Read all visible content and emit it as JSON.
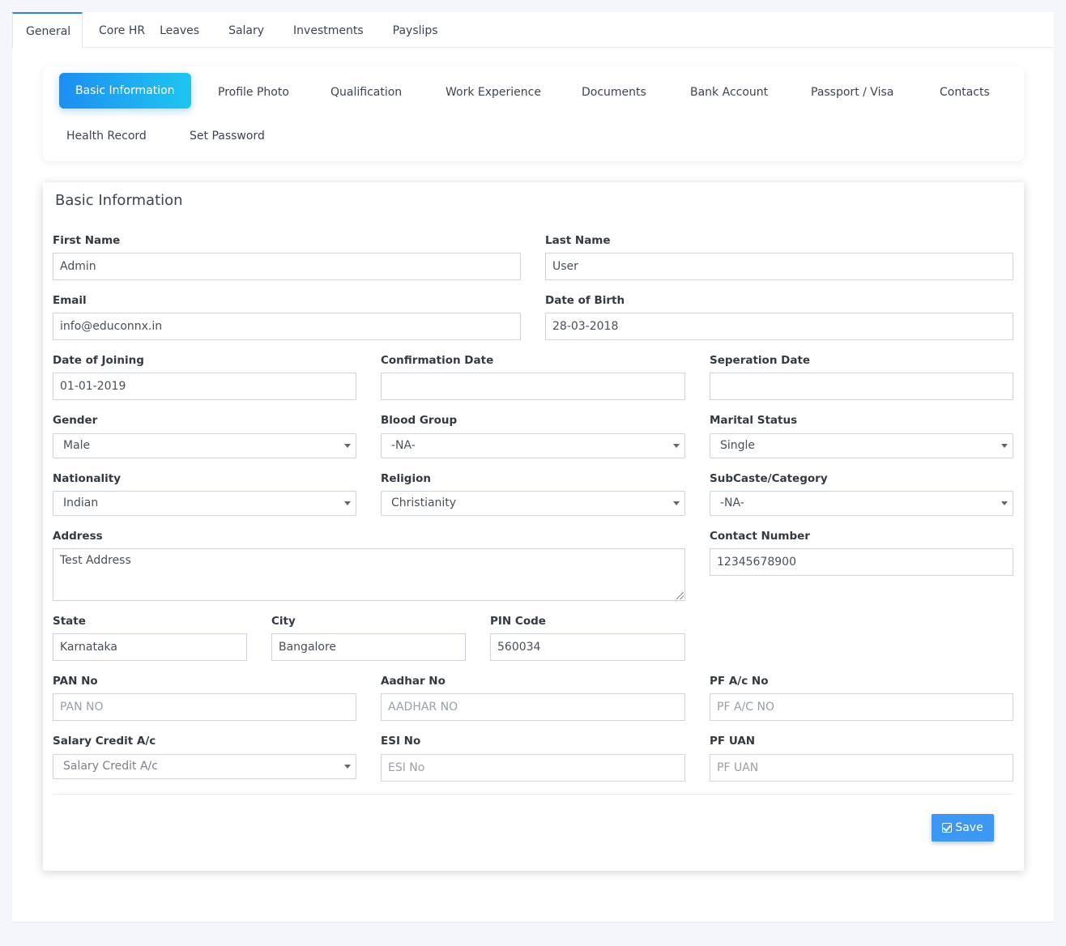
{
  "top_tabs": [
    "General",
    "Core HR",
    "Leaves",
    "Salary",
    "Investments",
    "Payslips"
  ],
  "sub_tabs": [
    "Basic Information",
    "Profile Photo",
    "Qualification",
    "Work Experience",
    "Documents",
    "Bank Account",
    "Passport / Visa",
    "Contacts",
    "Health Record",
    "Set Password"
  ],
  "form": {
    "title": "Basic Information",
    "first_name": {
      "label": "First Name",
      "value": "Admin"
    },
    "last_name": {
      "label": "Last Name",
      "value": "User"
    },
    "email": {
      "label": "Email",
      "value": "info@educonnx.in"
    },
    "dob": {
      "label": "Date of Birth",
      "value": "28-03-2018"
    },
    "doj": {
      "label": "Date of Joining",
      "value": "01-01-2019"
    },
    "confirmation_date": {
      "label": "Confirmation Date",
      "value": ""
    },
    "separation_date": {
      "label": "Seperation Date",
      "value": ""
    },
    "gender": {
      "label": "Gender",
      "value": "Male"
    },
    "blood_group": {
      "label": "Blood Group",
      "value": "-NA-"
    },
    "marital_status": {
      "label": "Marital Status",
      "value": "Single"
    },
    "nationality": {
      "label": "Nationality",
      "value": "Indian"
    },
    "religion": {
      "label": "Religion",
      "value": "Christianity"
    },
    "subcaste": {
      "label": "SubCaste/Category",
      "value": "-NA-"
    },
    "address": {
      "label": "Address",
      "value": "Test Address"
    },
    "contact_number": {
      "label": "Contact Number",
      "value": "12345678900"
    },
    "state": {
      "label": "State",
      "value": "Karnataka"
    },
    "city": {
      "label": "City",
      "value": "Bangalore"
    },
    "pin": {
      "label": "PIN Code",
      "value": "560034"
    },
    "pan": {
      "label": "PAN No",
      "placeholder": "PAN NO"
    },
    "aadhar": {
      "label": "Aadhar No",
      "placeholder": "AADHAR NO"
    },
    "pf_ac": {
      "label": "PF A/c No",
      "placeholder": "PF A/C NO"
    },
    "salary_credit": {
      "label": "Salary Credit A/c",
      "placeholder": "Salary Credit A/c"
    },
    "esi": {
      "label": "ESI No",
      "placeholder": "ESI No"
    },
    "pf_uan": {
      "label": "PF UAN",
      "placeholder": "PF UAN"
    },
    "save_label": "Save"
  },
  "colors": {
    "accent": "#3c98f0",
    "pill_gradient_start": "#1d8ef2",
    "pill_gradient_end": "#1ec6f0"
  }
}
